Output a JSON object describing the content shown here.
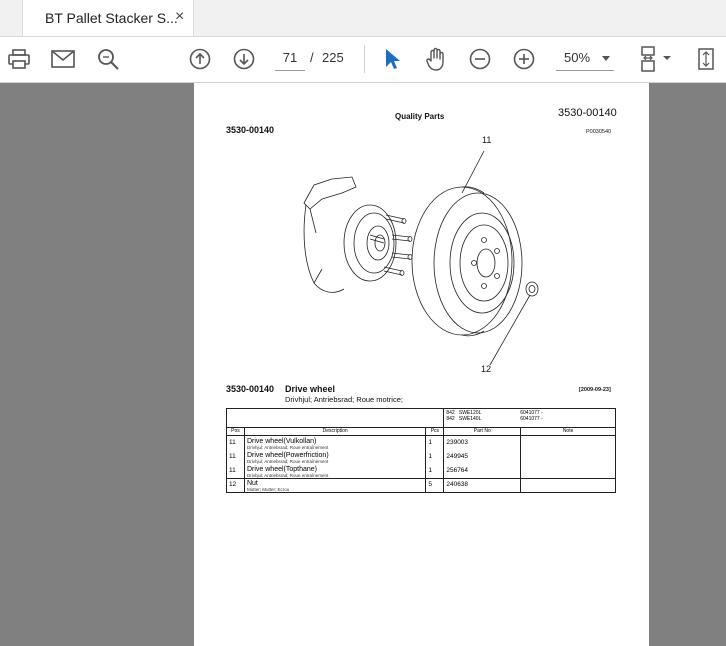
{
  "tab": {
    "title": "BT Pallet Stacker S...",
    "close": "×"
  },
  "toolbar": {
    "page_current": "71",
    "page_sep": "/",
    "page_total": "225",
    "zoom": "50%"
  },
  "doc": {
    "header_center": "Quality Parts",
    "header_right": "3530-00140",
    "header_left": "3530-00140",
    "image_ref": "P0030540",
    "callout_top": "11",
    "callout_bottom": "12",
    "section_code": "3530-00140",
    "section_title": "Drive wheel",
    "section_date": "[2009-09-23]",
    "section_translations": "Drivhjul; Antriebsrad; Roue motrice;",
    "models": [
      {
        "code": "842",
        "model": "SWE120L",
        "serial": "6041077 -"
      },
      {
        "code": "842",
        "model": "SWE140L",
        "serial": "6041077 -"
      }
    ],
    "columns": {
      "pos": "Pos",
      "description": "Description",
      "qty": "Pcs",
      "part_no": "Part No",
      "note": "Note"
    },
    "rows": [
      {
        "pos": "11",
        "desc": "Drive wheel(Vulkollan)",
        "sub": "Drivhjul; Antriebsrad; Roue entraînement",
        "qty": "1",
        "part": "239003",
        "note": ""
      },
      {
        "pos": "11",
        "desc": "Drive wheel(Powerfriction)",
        "sub": "Drivhjul; Antriebsrad; Roue entraînement",
        "qty": "1",
        "part": "249945",
        "note": ""
      },
      {
        "pos": "11",
        "desc": "Drive wheel(Topthane)",
        "sub": "Drivhjul; Antriebsrad; Roue entraînement",
        "qty": "1",
        "part": "256764",
        "note": ""
      },
      {
        "pos": "12",
        "desc": "Nut",
        "sub": "Mutter; Mutter; Ecrou",
        "qty": "5",
        "part": "240638",
        "note": ""
      }
    ]
  }
}
